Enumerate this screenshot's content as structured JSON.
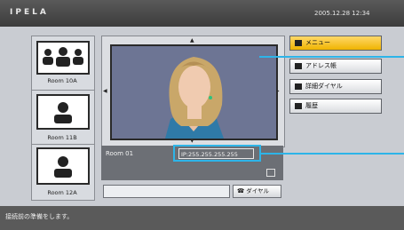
{
  "app": {
    "logo": "IPELA",
    "datetime": "2005.12.28 12:34"
  },
  "rooms": [
    {
      "label": "Room 10A",
      "icon": "group-icon"
    },
    {
      "label": "Room 11B",
      "icon": "person-icon"
    },
    {
      "label": "Room 12A",
      "icon": "person-icon"
    }
  ],
  "video": {
    "room_label": "Room 01",
    "ip": "IP:255.255.255.255",
    "arrows": {
      "up": "▲",
      "down": "▼",
      "left": "◀",
      "right": "▶"
    }
  },
  "dial": {
    "input_value": "",
    "button_label": "ダイヤル"
  },
  "menu": {
    "items": [
      {
        "label": "メニュー",
        "icon": "menu-icon",
        "active": true
      },
      {
        "label": "アドレス帳",
        "icon": "address-book-icon",
        "active": false
      },
      {
        "label": "詳細ダイヤル",
        "icon": "detail-dial-icon",
        "active": false
      },
      {
        "label": "履歴",
        "icon": "history-icon",
        "active": false
      }
    ]
  },
  "status": {
    "text": "接続前の準備をします。"
  },
  "colors": {
    "highlight": "#2db4e8",
    "active_menu": "#f5c022",
    "screen": "#6d7594"
  }
}
